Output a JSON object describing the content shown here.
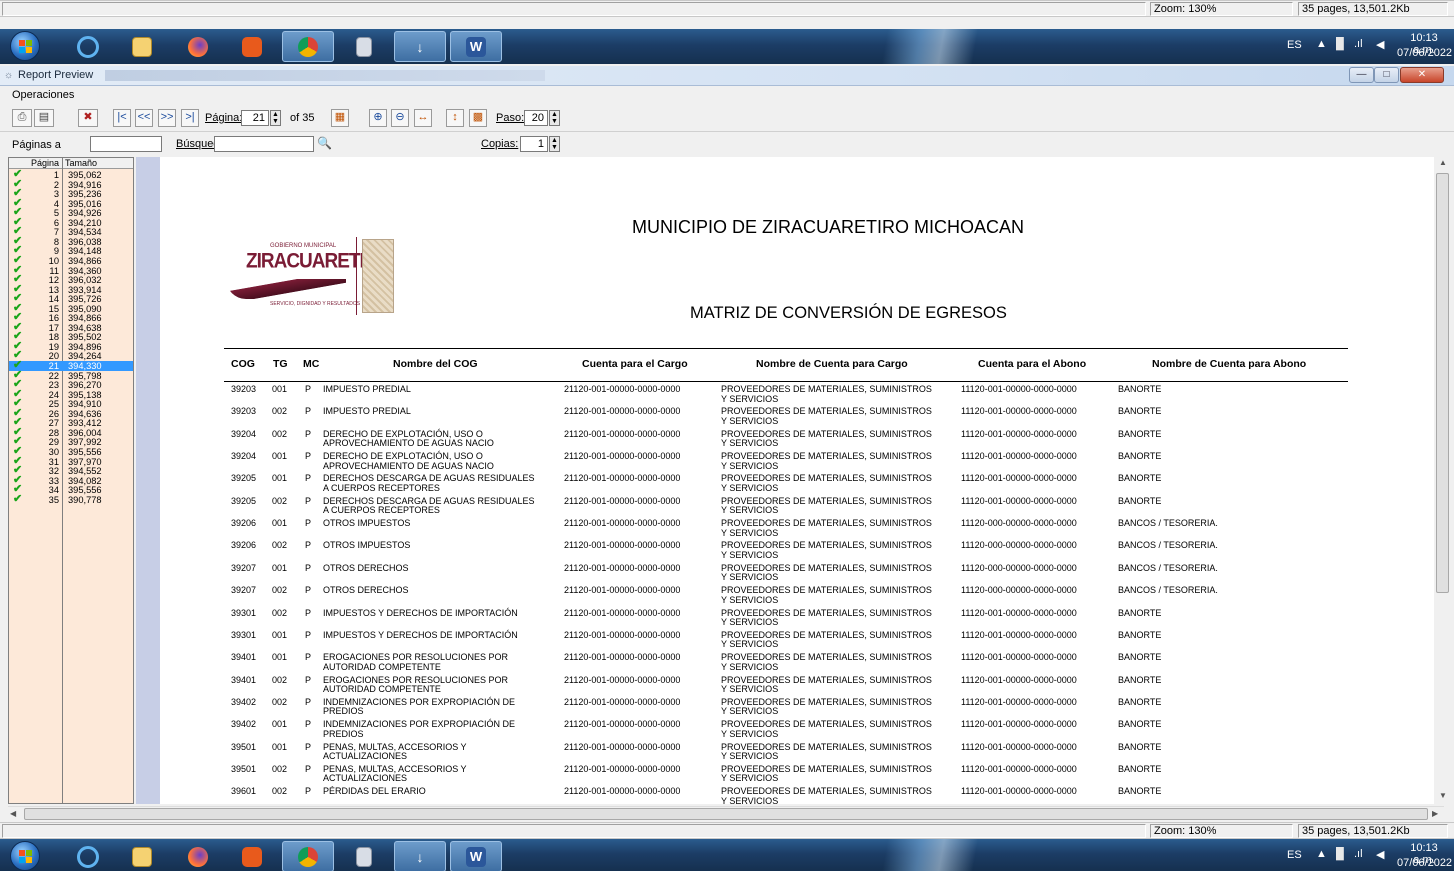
{
  "status_top": {
    "zoom": "Zoom: 130%",
    "info": "35 pages, 13,501.2Kb"
  },
  "status_bottom": {
    "zoom": "Zoom: 130%",
    "info": "35 pages, 13,501.2Kb"
  },
  "tray": {
    "lang": "ES",
    "time": "10:13 a.m.",
    "date": "07/06/2022"
  },
  "window": {
    "title": "Report Preview"
  },
  "menu": {
    "operations": "Operaciones"
  },
  "toolbar": {
    "page_label": "Página:",
    "page_value": "21",
    "of_label": "of 35",
    "step_label": "Paso:",
    "step_value": "20",
    "pages_label": "Páginas a",
    "search_label": "Búsqued",
    "copies_label": "Copias:",
    "copies_value": "1"
  },
  "page_list": {
    "headers": [
      "Página",
      "Tamaño"
    ],
    "selected": 21,
    "rows": [
      [
        "1",
        "395,062"
      ],
      [
        "2",
        "394,916"
      ],
      [
        "3",
        "395,236"
      ],
      [
        "4",
        "395,016"
      ],
      [
        "5",
        "394,926"
      ],
      [
        "6",
        "394,210"
      ],
      [
        "7",
        "394,534"
      ],
      [
        "8",
        "396,038"
      ],
      [
        "9",
        "394,148"
      ],
      [
        "10",
        "394,866"
      ],
      [
        "11",
        "394,360"
      ],
      [
        "12",
        "396,032"
      ],
      [
        "13",
        "393,914"
      ],
      [
        "14",
        "395,726"
      ],
      [
        "15",
        "395,090"
      ],
      [
        "16",
        "394,866"
      ],
      [
        "17",
        "394,638"
      ],
      [
        "18",
        "395,502"
      ],
      [
        "19",
        "394,896"
      ],
      [
        "20",
        "394,264"
      ],
      [
        "21",
        "394,330"
      ],
      [
        "22",
        "395,798"
      ],
      [
        "23",
        "396,270"
      ],
      [
        "24",
        "395,138"
      ],
      [
        "25",
        "394,910"
      ],
      [
        "26",
        "394,636"
      ],
      [
        "27",
        "393,412"
      ],
      [
        "28",
        "396,004"
      ],
      [
        "29",
        "397,992"
      ],
      [
        "30",
        "395,556"
      ],
      [
        "31",
        "397,970"
      ],
      [
        "32",
        "394,552"
      ],
      [
        "33",
        "394,082"
      ],
      [
        "34",
        "395,556"
      ],
      [
        "35",
        "390,778"
      ]
    ]
  },
  "report": {
    "logo_top": "GOBIERNO MUNICIPAL",
    "logo_name": "ZIRACUARETIRO",
    "logo_tagline": "SERVICIO, DIGNIDAD Y RESULTADOS",
    "title": "MUNICIPIO DE ZIRACUARETIRO MICHOACAN",
    "subtitle": "MATRIZ DE CONVERSIÓN DE EGRESOS",
    "columns": [
      "COG",
      "TG",
      "MC",
      "Nombre del COG",
      "Cuenta para el Cargo",
      "Nombre de Cuenta para Cargo",
      "Cuenta para el Abono",
      "Nombre de Cuenta para Abono"
    ],
    "rows": [
      {
        "cog": "39203",
        "tg": "001",
        "mc": "P",
        "name": [
          "IMPUESTO PREDIAL"
        ],
        "cargo": "21120-001-00000-0000-0000",
        "ncargo": [
          "PROVEEDORES DE MATERIALES, SUMINISTROS",
          "Y SERVICIOS"
        ],
        "abono": "11120-001-00000-0000-0000",
        "nabono": "BANORTE"
      },
      {
        "cog": "39203",
        "tg": "002",
        "mc": "P",
        "name": [
          "IMPUESTO PREDIAL"
        ],
        "cargo": "21120-001-00000-0000-0000",
        "ncargo": [
          "PROVEEDORES DE MATERIALES, SUMINISTROS",
          "Y SERVICIOS"
        ],
        "abono": "11120-001-00000-0000-0000",
        "nabono": "BANORTE"
      },
      {
        "cog": "39204",
        "tg": "002",
        "mc": "P",
        "name": [
          "DERECHO DE EXPLOTACIÓN, USO O",
          "APROVECHAMIENTO DE AGUAS NACIO"
        ],
        "cargo": "21120-001-00000-0000-0000",
        "ncargo": [
          "PROVEEDORES DE MATERIALES, SUMINISTROS",
          "Y SERVICIOS"
        ],
        "abono": "11120-001-00000-0000-0000",
        "nabono": "BANORTE"
      },
      {
        "cog": "39204",
        "tg": "001",
        "mc": "P",
        "name": [
          "DERECHO DE EXPLOTACIÓN, USO O",
          "APROVECHAMIENTO DE AGUAS NACIO"
        ],
        "cargo": "21120-001-00000-0000-0000",
        "ncargo": [
          "PROVEEDORES DE MATERIALES, SUMINISTROS",
          "Y SERVICIOS"
        ],
        "abono": "11120-001-00000-0000-0000",
        "nabono": "BANORTE"
      },
      {
        "cog": "39205",
        "tg": "001",
        "mc": "P",
        "name": [
          "DERECHOS DESCARGA DE AGUAS RESIDUALES",
          "A CUERPOS RECEPTORES"
        ],
        "cargo": "21120-001-00000-0000-0000",
        "ncargo": [
          "PROVEEDORES DE MATERIALES, SUMINISTROS",
          "Y SERVICIOS"
        ],
        "abono": "11120-001-00000-0000-0000",
        "nabono": "BANORTE"
      },
      {
        "cog": "39205",
        "tg": "002",
        "mc": "P",
        "name": [
          "DERECHOS DESCARGA DE AGUAS RESIDUALES",
          "A CUERPOS RECEPTORES"
        ],
        "cargo": "21120-001-00000-0000-0000",
        "ncargo": [
          "PROVEEDORES DE MATERIALES, SUMINISTROS",
          "Y SERVICIOS"
        ],
        "abono": "11120-001-00000-0000-0000",
        "nabono": "BANORTE"
      },
      {
        "cog": "39206",
        "tg": "001",
        "mc": "P",
        "name": [
          "OTROS IMPUESTOS"
        ],
        "cargo": "21120-001-00000-0000-0000",
        "ncargo": [
          "PROVEEDORES DE MATERIALES, SUMINISTROS",
          "Y SERVICIOS"
        ],
        "abono": "11120-000-00000-0000-0000",
        "nabono": "BANCOS / TESORERIA."
      },
      {
        "cog": "39206",
        "tg": "002",
        "mc": "P",
        "name": [
          "OTROS IMPUESTOS"
        ],
        "cargo": "21120-001-00000-0000-0000",
        "ncargo": [
          "PROVEEDORES DE MATERIALES, SUMINISTROS",
          "Y SERVICIOS"
        ],
        "abono": "11120-000-00000-0000-0000",
        "nabono": "BANCOS / TESORERIA."
      },
      {
        "cog": "39207",
        "tg": "001",
        "mc": "P",
        "name": [
          "OTROS DERECHOS"
        ],
        "cargo": "21120-001-00000-0000-0000",
        "ncargo": [
          "PROVEEDORES DE MATERIALES, SUMINISTROS",
          "Y SERVICIOS"
        ],
        "abono": "11120-000-00000-0000-0000",
        "nabono": "BANCOS / TESORERIA."
      },
      {
        "cog": "39207",
        "tg": "002",
        "mc": "P",
        "name": [
          "OTROS DERECHOS"
        ],
        "cargo": "21120-001-00000-0000-0000",
        "ncargo": [
          "PROVEEDORES DE MATERIALES, SUMINISTROS",
          "Y SERVICIOS"
        ],
        "abono": "11120-000-00000-0000-0000",
        "nabono": "BANCOS / TESORERIA."
      },
      {
        "cog": "39301",
        "tg": "002",
        "mc": "P",
        "name": [
          "IMPUESTOS Y DERECHOS DE IMPORTACIÓN"
        ],
        "cargo": "21120-001-00000-0000-0000",
        "ncargo": [
          "PROVEEDORES DE MATERIALES, SUMINISTROS",
          "Y SERVICIOS"
        ],
        "abono": "11120-001-00000-0000-0000",
        "nabono": "BANORTE"
      },
      {
        "cog": "39301",
        "tg": "001",
        "mc": "P",
        "name": [
          "IMPUESTOS Y DERECHOS DE IMPORTACIÓN"
        ],
        "cargo": "21120-001-00000-0000-0000",
        "ncargo": [
          "PROVEEDORES DE MATERIALES, SUMINISTROS",
          "Y SERVICIOS"
        ],
        "abono": "11120-001-00000-0000-0000",
        "nabono": "BANORTE"
      },
      {
        "cog": "39401",
        "tg": "001",
        "mc": "P",
        "name": [
          "EROGACIONES POR RESOLUCIONES POR",
          "AUTORIDAD COMPETENTE"
        ],
        "cargo": "21120-001-00000-0000-0000",
        "ncargo": [
          "PROVEEDORES DE MATERIALES, SUMINISTROS",
          "Y SERVICIOS"
        ],
        "abono": "11120-001-00000-0000-0000",
        "nabono": "BANORTE"
      },
      {
        "cog": "39401",
        "tg": "002",
        "mc": "P",
        "name": [
          "EROGACIONES POR RESOLUCIONES POR",
          "AUTORIDAD COMPETENTE"
        ],
        "cargo": "21120-001-00000-0000-0000",
        "ncargo": [
          "PROVEEDORES DE MATERIALES, SUMINISTROS",
          "Y SERVICIOS"
        ],
        "abono": "11120-001-00000-0000-0000",
        "nabono": "BANORTE"
      },
      {
        "cog": "39402",
        "tg": "002",
        "mc": "P",
        "name": [
          "INDEMNIZACIONES POR EXPROPIACIÓN DE",
          "PREDIOS"
        ],
        "cargo": "21120-001-00000-0000-0000",
        "ncargo": [
          "PROVEEDORES DE MATERIALES, SUMINISTROS",
          "Y SERVICIOS"
        ],
        "abono": "11120-001-00000-0000-0000",
        "nabono": "BANORTE"
      },
      {
        "cog": "39402",
        "tg": "001",
        "mc": "P",
        "name": [
          "INDEMNIZACIONES POR EXPROPIACIÓN DE",
          "PREDIOS"
        ],
        "cargo": "21120-001-00000-0000-0000",
        "ncargo": [
          "PROVEEDORES DE MATERIALES, SUMINISTROS",
          "Y SERVICIOS"
        ],
        "abono": "11120-001-00000-0000-0000",
        "nabono": "BANORTE"
      },
      {
        "cog": "39501",
        "tg": "001",
        "mc": "P",
        "name": [
          "PENAS, MULTAS, ACCESORIOS Y",
          "ACTUALIZACIONES"
        ],
        "cargo": "21120-001-00000-0000-0000",
        "ncargo": [
          "PROVEEDORES DE MATERIALES, SUMINISTROS",
          "Y SERVICIOS"
        ],
        "abono": "11120-001-00000-0000-0000",
        "nabono": "BANORTE"
      },
      {
        "cog": "39501",
        "tg": "002",
        "mc": "P",
        "name": [
          "PENAS, MULTAS, ACCESORIOS Y",
          "ACTUALIZACIONES"
        ],
        "cargo": "21120-001-00000-0000-0000",
        "ncargo": [
          "PROVEEDORES DE MATERIALES, SUMINISTROS",
          "Y SERVICIOS"
        ],
        "abono": "11120-001-00000-0000-0000",
        "nabono": "BANORTE"
      },
      {
        "cog": "39601",
        "tg": "002",
        "mc": "P",
        "name": [
          "PÉRDIDAS DEL ERARIO"
        ],
        "cargo": "21120-001-00000-0000-0000",
        "ncargo": [
          "PROVEEDORES DE MATERIALES, SUMINISTROS",
          "Y SERVICIOS"
        ],
        "abono": "11120-001-00000-0000-0000",
        "nabono": "BANORTE"
      }
    ]
  },
  "colors": {
    "accent": "#3399ff",
    "page_list_bg": "#fde9d9",
    "taskbar": "#1c3d66",
    "logo_maroon": "#7a1c35"
  }
}
